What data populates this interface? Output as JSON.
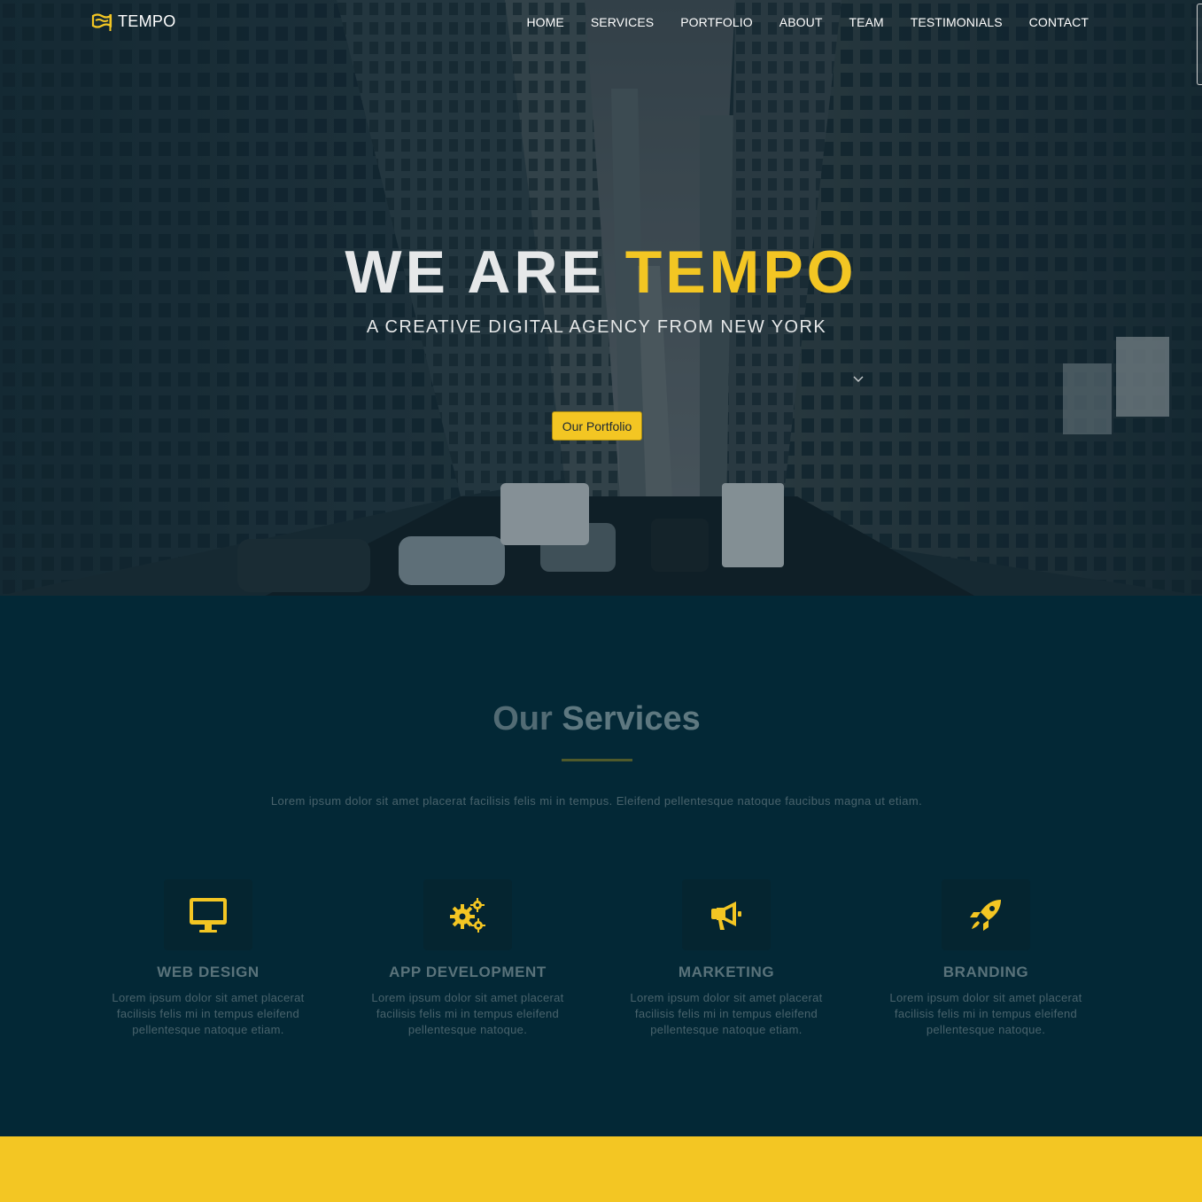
{
  "brand": {
    "name": "TEMPO",
    "icon": "flag-logo-icon"
  },
  "nav": {
    "items": [
      "HOME",
      "SERVICES",
      "PORTFOLIO",
      "ABOUT",
      "TEAM",
      "TESTIMONIALS",
      "CONTACT"
    ]
  },
  "hero": {
    "title_prefix": "WE ARE ",
    "title_accent": "TEMPO",
    "subtitle": "A CREATIVE DIGITAL AGENCY FROM NEW YORK",
    "button_label": "Our Portfolio",
    "background": "city street between skyscrapers"
  },
  "services": {
    "title_light": "Our ",
    "title_bold": "Services",
    "description": "Lorem ipsum dolor sit amet placerat facilisis felis mi in tempus. Eleifend pellentesque natoque faucibus magna ut etiam.",
    "items": [
      {
        "icon": "desktop-icon",
        "title": "WEB DESIGN",
        "text": "Lorem ipsum dolor sit amet placerat facilisis felis mi in tempus eleifend pellentesque natoque etiam."
      },
      {
        "icon": "gears-icon",
        "title": "APP DEVELOPMENT",
        "text": "Lorem ipsum dolor sit amet placerat facilisis felis mi in tempus eleifend pellentesque natoque."
      },
      {
        "icon": "megaphone-icon",
        "title": "MARKETING",
        "text": "Lorem ipsum dolor sit amet placerat facilisis felis mi in tempus eleifend pellentesque natoque etiam."
      },
      {
        "icon": "rocket-icon",
        "title": "BRANDING",
        "text": "Lorem ipsum dolor sit amet placerat facilisis felis mi in tempus eleifend pellentesque natoque."
      }
    ]
  },
  "colors": {
    "accent": "#f3c623",
    "section_bg": "#032836",
    "text_muted": "#49636c"
  }
}
